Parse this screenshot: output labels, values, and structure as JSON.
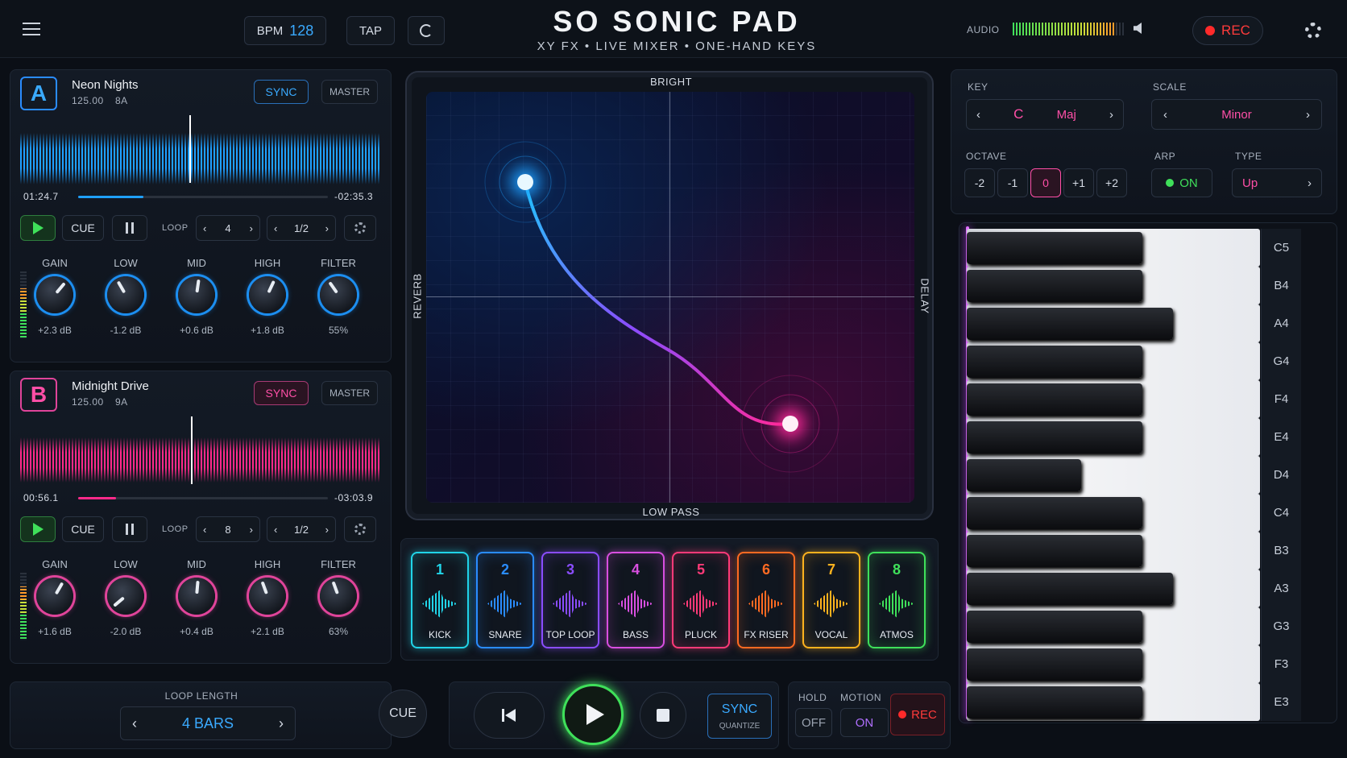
{
  "header": {
    "title": "SO SONIC PAD",
    "subtitle": "XY FX • LIVE MIXER • ONE-HAND KEYS",
    "bpm_label": "BPM",
    "bpm": "128",
    "tap": "TAP",
    "audio": "AUDIO",
    "rec": "REC",
    "menu_icon": "hamburger-icon",
    "settings_icon": "gear-icon"
  },
  "deck_a": {
    "letter": "A",
    "title": "Neon Nights",
    "bpm": "125.00",
    "key": "8A",
    "sync": "SYNC",
    "master": "MASTER",
    "elapsed": "01:24.7",
    "remaining": "-02:35.3",
    "progress": 0.26,
    "cue": "CUE",
    "loop": "LOOP",
    "loop_val": "4",
    "div_val": "1/2",
    "knobs": [
      {
        "label": "GAIN",
        "value": "+2.3 dB",
        "angle": 40
      },
      {
        "label": "LOW",
        "value": "-1.2 dB",
        "angle": -30
      },
      {
        "label": "MID",
        "value": "+0.6 dB",
        "angle": 8
      },
      {
        "label": "HIGH",
        "value": "+1.8 dB",
        "angle": 25
      },
      {
        "label": "FILTER",
        "value": "55%",
        "angle": -35
      }
    ]
  },
  "deck_b": {
    "letter": "B",
    "title": "Midnight Drive",
    "bpm": "125.00",
    "key": "9A",
    "sync": "SYNC",
    "master": "MASTER",
    "elapsed": "00:56.1",
    "remaining": "-03:03.9",
    "progress": 0.15,
    "cue": "CUE",
    "loop": "LOOP",
    "loop_val": "8",
    "div_val": "1/2",
    "knobs": [
      {
        "label": "GAIN",
        "value": "+1.6 dB",
        "angle": 30
      },
      {
        "label": "LOW",
        "value": "-2.0 dB",
        "angle": -130
      },
      {
        "label": "MID",
        "value": "+0.4 dB",
        "angle": 5
      },
      {
        "label": "HIGH",
        "value": "+2.1 dB",
        "angle": -20
      },
      {
        "label": "FILTER",
        "value": "63%",
        "angle": -20
      }
    ]
  },
  "xy": {
    "top": "BRIGHT",
    "bottom": "LOW PASS",
    "left": "REVERB",
    "right": "DELAY"
  },
  "pads": [
    {
      "n": "1",
      "name": "KICK",
      "color": "#21d4e8"
    },
    {
      "n": "2",
      "name": "SNARE",
      "color": "#2a8cff"
    },
    {
      "n": "3",
      "name": "TOP LOOP",
      "color": "#8a4dff"
    },
    {
      "n": "4",
      "name": "BASS",
      "color": "#d84fe0"
    },
    {
      "n": "5",
      "name": "PLUCK",
      "color": "#ff3a78"
    },
    {
      "n": "6",
      "name": "FX RISER",
      "color": "#ff6a22"
    },
    {
      "n": "7",
      "name": "VOCAL",
      "color": "#ffb21e"
    },
    {
      "n": "8",
      "name": "ATMOS",
      "color": "#3fe05a"
    }
  ],
  "keys": {
    "key_label": "KEY",
    "key": "C",
    "mode": "Maj",
    "scale_label": "SCALE",
    "scale": "Minor",
    "octave_label": "OCTAVE",
    "octaves": [
      "-2",
      "-1",
      "0",
      "+1",
      "+2"
    ],
    "arp_label": "ARP",
    "arp": "ON",
    "type_label": "TYPE",
    "type": "Up",
    "notes": [
      "C5",
      "B4",
      "A4",
      "G4",
      "F4",
      "E4",
      "D4",
      "C4",
      "B3",
      "A3",
      "G3",
      "F3",
      "E3"
    ]
  },
  "bottom": {
    "loop_length_label": "LOOP LENGTH",
    "loop_length": "4 BARS",
    "cue": "CUE",
    "sync": "SYNC",
    "quantize": "QUANTIZE",
    "hold": "HOLD",
    "hold_val": "OFF",
    "motion": "MOTION",
    "motion_val": "ON",
    "rec": "REC"
  }
}
